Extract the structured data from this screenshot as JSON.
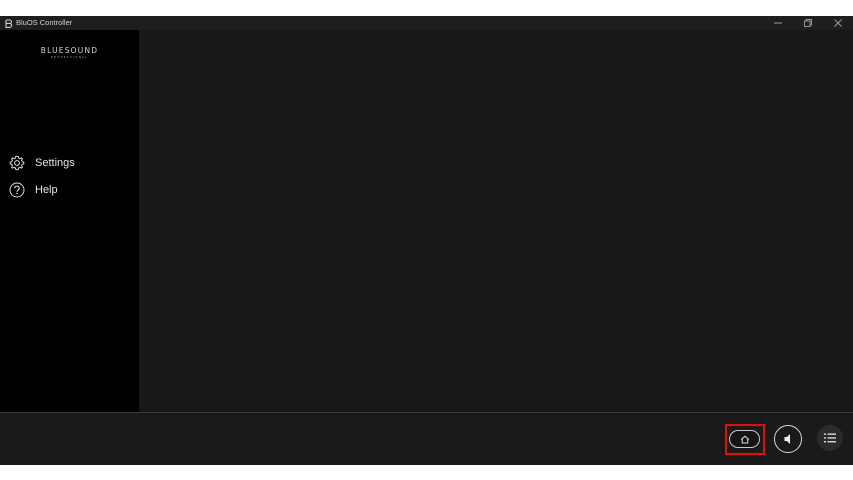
{
  "window": {
    "title": "BluOS Controller",
    "app_icon": "bluos-b-icon",
    "controls": [
      "minimize-icon",
      "restore-icon",
      "close-icon"
    ]
  },
  "sidebar": {
    "logo": {
      "main": "BLUESOUND",
      "sub": "PROFESSIONAL"
    },
    "items": [
      {
        "label": "Settings",
        "icon": "gear-icon"
      },
      {
        "label": "Help",
        "icon": "help-circle-icon"
      }
    ]
  },
  "bottom_bar": {
    "buttons": [
      {
        "name": "home",
        "icon": "home-icon",
        "highlighted": true
      },
      {
        "name": "volume",
        "icon": "speaker-icon"
      },
      {
        "name": "queue",
        "icon": "list-icon"
      }
    ]
  },
  "colors": {
    "background": "#181818",
    "sidebar": "#000000",
    "highlight": "#e01010",
    "text": "#e6e6e6"
  }
}
